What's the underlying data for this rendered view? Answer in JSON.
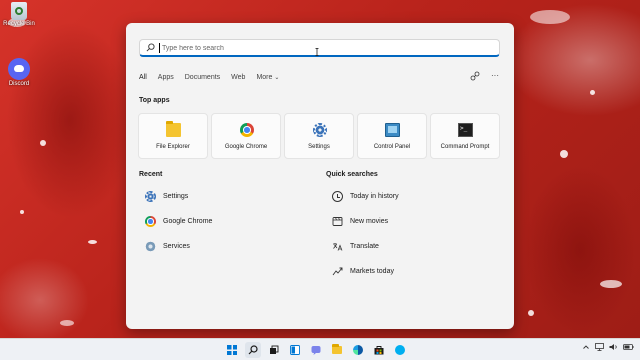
{
  "desktop": {
    "icons": [
      {
        "label": "Recycle Bin",
        "icon": "recycle-bin-icon"
      },
      {
        "label": "Discord",
        "icon": "discord-icon"
      }
    ]
  },
  "search": {
    "placeholder": "Type here to search",
    "value": ""
  },
  "tabs": [
    {
      "label": "All",
      "active": true
    },
    {
      "label": "Apps"
    },
    {
      "label": "Documents"
    },
    {
      "label": "Web"
    },
    {
      "label": "More"
    }
  ],
  "tabs_right": {
    "share_icon": "share-icon",
    "more_icon": "ellipsis-icon",
    "more_glyph": "···"
  },
  "top_apps": {
    "title": "Top apps",
    "items": [
      {
        "label": "File Explorer",
        "icon": "folder-icon"
      },
      {
        "label": "Google Chrome",
        "icon": "chrome-icon"
      },
      {
        "label": "Settings",
        "icon": "gear-icon"
      },
      {
        "label": "Control Panel",
        "icon": "control-panel-icon"
      },
      {
        "label": "Command Prompt",
        "icon": "command-prompt-icon"
      }
    ]
  },
  "recent": {
    "title": "Recent",
    "items": [
      {
        "label": "Settings",
        "icon": "gear-icon"
      },
      {
        "label": "Google Chrome",
        "icon": "chrome-icon"
      },
      {
        "label": "Services",
        "icon": "services-icon"
      }
    ]
  },
  "quick_searches": {
    "title": "Quick searches",
    "items": [
      {
        "label": "Today in history",
        "icon": "clock-icon"
      },
      {
        "label": "New movies",
        "icon": "film-icon"
      },
      {
        "label": "Translate",
        "icon": "translate-icon"
      },
      {
        "label": "Markets today",
        "icon": "chart-icon"
      }
    ]
  },
  "taskbar": {
    "items": [
      "start-icon",
      "search-icon",
      "task-view-icon",
      "widgets-icon",
      "chat-icon",
      "file-explorer-icon",
      "edge-icon",
      "store-icon",
      "skype-icon"
    ],
    "tray": [
      "chevron-up-icon",
      "network-icon",
      "volume-icon",
      "battery-icon"
    ]
  },
  "colors": {
    "accent": "#0067c0",
    "wallpaper": "#c0281d"
  }
}
